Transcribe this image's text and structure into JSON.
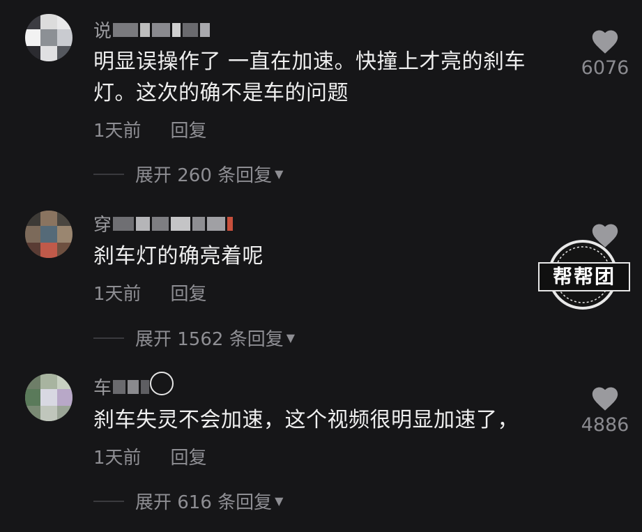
{
  "colors": {
    "background": "#161618",
    "text_primary": "#efefef",
    "text_secondary": "#8e8e93",
    "like_icon": "#9a9a9e"
  },
  "comments": [
    {
      "username_prefix": "说",
      "text": "明显误操作了 一直在加速。快撞上才亮的刹车灯。这次的确不是车的问题",
      "time": "1天前",
      "reply_label": "回复",
      "expand_label": "展开 260 条回复",
      "like_icon": "heart-icon",
      "like_count": "6076"
    },
    {
      "username_prefix": "穿",
      "text": "刹车灯的确亮着呢",
      "time": "1天前",
      "reply_label": "回复",
      "expand_label": "展开 1562 条回复",
      "like_icon": "heart-icon",
      "like_count": ""
    },
    {
      "username_prefix": "车",
      "text": "刹车失灵不会加速，这个视频很明显加速了，",
      "time": "1天前",
      "reply_label": "回复",
      "expand_label": "展开 616 条回复",
      "like_icon": "heart-icon",
      "like_count": "4886"
    }
  ],
  "watermark": {
    "text": "帮帮团"
  }
}
